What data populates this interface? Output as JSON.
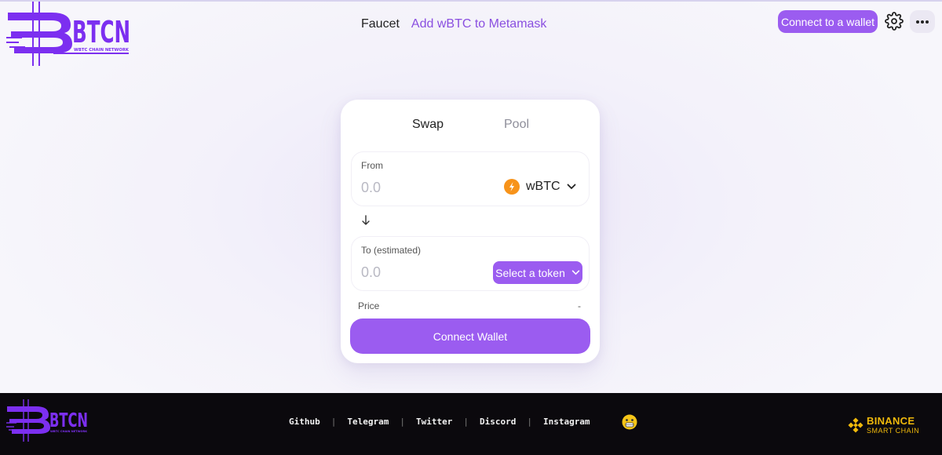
{
  "header": {
    "logo": {
      "text": "BTCN",
      "tagline": "WBTC CHAIN NETWORK"
    },
    "nav": {
      "faucet": "Faucet",
      "metamask": "Add wBTC to Metamask"
    },
    "connect_label": "Connect to a wallet",
    "settings_icon": "gear-icon",
    "more_icon": "more-icon"
  },
  "swap": {
    "tabs": {
      "swap": "Swap",
      "pool": "Pool"
    },
    "from": {
      "label": "From",
      "placeholder": "0.0",
      "token": "wBTC",
      "token_icon": "wbtc-token-icon"
    },
    "to": {
      "label": "To (estimated)",
      "placeholder": "0.0",
      "select_label": "Select a token"
    },
    "price": {
      "label": "Price",
      "value": "-"
    },
    "connect_label": "Connect Wallet"
  },
  "footer": {
    "logo": {
      "text": "BTCN",
      "tagline": "WBTC CHAIN NETWORK"
    },
    "links": [
      "Github",
      "Telegram",
      "Twitter",
      "Discord",
      "Instagram"
    ],
    "binance": {
      "title": "BINANCE",
      "subtitle": "SMART CHAIN"
    }
  },
  "colors": {
    "accent": "#9b5cf0",
    "link": "#8a4fe0",
    "footer_bg": "#0b090d",
    "binance": "#f0b90b"
  }
}
